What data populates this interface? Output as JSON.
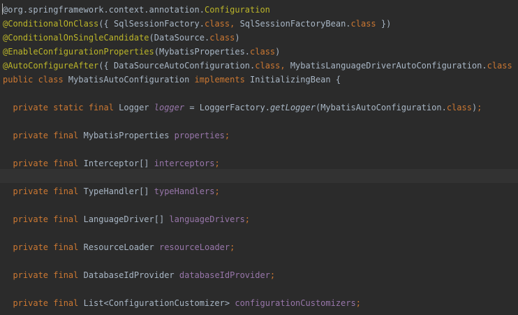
{
  "lines": [
    [
      {
        "t": "@org.springframework.context.annotation.",
        "c": "tx"
      },
      {
        "t": "Configuration",
        "c": "ann"
      }
    ],
    [
      {
        "t": "@ConditionalOnClass",
        "c": "ann"
      },
      {
        "t": "({ SqlSessionFactory.",
        "c": "tx"
      },
      {
        "t": "class",
        "c": "kw"
      },
      {
        "t": ", ",
        "c": "kw"
      },
      {
        "t": "SqlSessionFactoryBean.",
        "c": "tx"
      },
      {
        "t": "class",
        "c": "kw"
      },
      {
        "t": " })",
        "c": "tx"
      }
    ],
    [
      {
        "t": "@ConditionalOnSingleCandidate",
        "c": "ann"
      },
      {
        "t": "(DataSource.",
        "c": "tx"
      },
      {
        "t": "class",
        "c": "kw"
      },
      {
        "t": ")",
        "c": "tx"
      }
    ],
    [
      {
        "t": "@EnableConfigurationProperties",
        "c": "ann"
      },
      {
        "t": "(MybatisProperties.",
        "c": "tx"
      },
      {
        "t": "class",
        "c": "kw"
      },
      {
        "t": ")",
        "c": "tx"
      }
    ],
    [
      {
        "t": "@AutoConfigureAfter",
        "c": "ann"
      },
      {
        "t": "({ DataSourceAutoConfiguration.",
        "c": "tx"
      },
      {
        "t": "class",
        "c": "kw"
      },
      {
        "t": ", ",
        "c": "kw"
      },
      {
        "t": "MybatisLanguageDriverAutoConfiguration.",
        "c": "tx"
      },
      {
        "t": "class",
        "c": "kw"
      },
      {
        "t": " })",
        "c": "tx"
      }
    ],
    [
      {
        "t": "public class ",
        "c": "kw"
      },
      {
        "t": "MybatisAutoConfiguration ",
        "c": "tx"
      },
      {
        "t": "implements ",
        "c": "kw"
      },
      {
        "t": "InitializingBean {",
        "c": "tx"
      }
    ],
    [],
    [
      {
        "t": "  private static final ",
        "c": "kw"
      },
      {
        "t": "Logger ",
        "c": "tx"
      },
      {
        "t": "logger",
        "c": "it"
      },
      {
        "t": " = LoggerFactory.",
        "c": "tx"
      },
      {
        "t": "getLogger",
        "c": "fn"
      },
      {
        "t": "(MybatisAutoConfiguration.",
        "c": "tx"
      },
      {
        "t": "class",
        "c": "kw"
      },
      {
        "t": ")",
        "c": "tx"
      },
      {
        "t": ";",
        "c": "kw"
      }
    ],
    [],
    [
      {
        "t": "  private final ",
        "c": "kw"
      },
      {
        "t": "MybatisProperties ",
        "c": "tx"
      },
      {
        "t": "properties",
        "c": "fld"
      },
      {
        "t": ";",
        "c": "kw"
      }
    ],
    [],
    [
      {
        "t": "  private final ",
        "c": "kw"
      },
      {
        "t": "Interceptor[] ",
        "c": "tx"
      },
      {
        "t": "interceptors",
        "c": "fld"
      },
      {
        "t": ";",
        "c": "kw"
      }
    ],
    [],
    [
      {
        "t": "  private final ",
        "c": "kw"
      },
      {
        "t": "TypeHandler[] ",
        "c": "tx"
      },
      {
        "t": "typeHandlers",
        "c": "fld"
      },
      {
        "t": ";",
        "c": "kw"
      }
    ],
    [],
    [
      {
        "t": "  private final ",
        "c": "kw"
      },
      {
        "t": "LanguageDriver[] ",
        "c": "tx"
      },
      {
        "t": "languageDrivers",
        "c": "fld"
      },
      {
        "t": ";",
        "c": "kw"
      }
    ],
    [],
    [
      {
        "t": "  private final ",
        "c": "kw"
      },
      {
        "t": "ResourceLoader ",
        "c": "tx"
      },
      {
        "t": "resourceLoader",
        "c": "fld"
      },
      {
        "t": ";",
        "c": "kw"
      }
    ],
    [],
    [
      {
        "t": "  private final ",
        "c": "kw"
      },
      {
        "t": "DatabaseIdProvider ",
        "c": "tx"
      },
      {
        "t": "databaseIdProvider",
        "c": "fld"
      },
      {
        "t": ";",
        "c": "kw"
      }
    ],
    [],
    [
      {
        "t": "  private final ",
        "c": "kw"
      },
      {
        "t": "List<ConfigurationCustomizer> ",
        "c": "tx"
      },
      {
        "t": "configurationCustomizers",
        "c": "fld"
      },
      {
        "t": ";",
        "c": "kw"
      }
    ]
  ],
  "current_line_index": 12
}
